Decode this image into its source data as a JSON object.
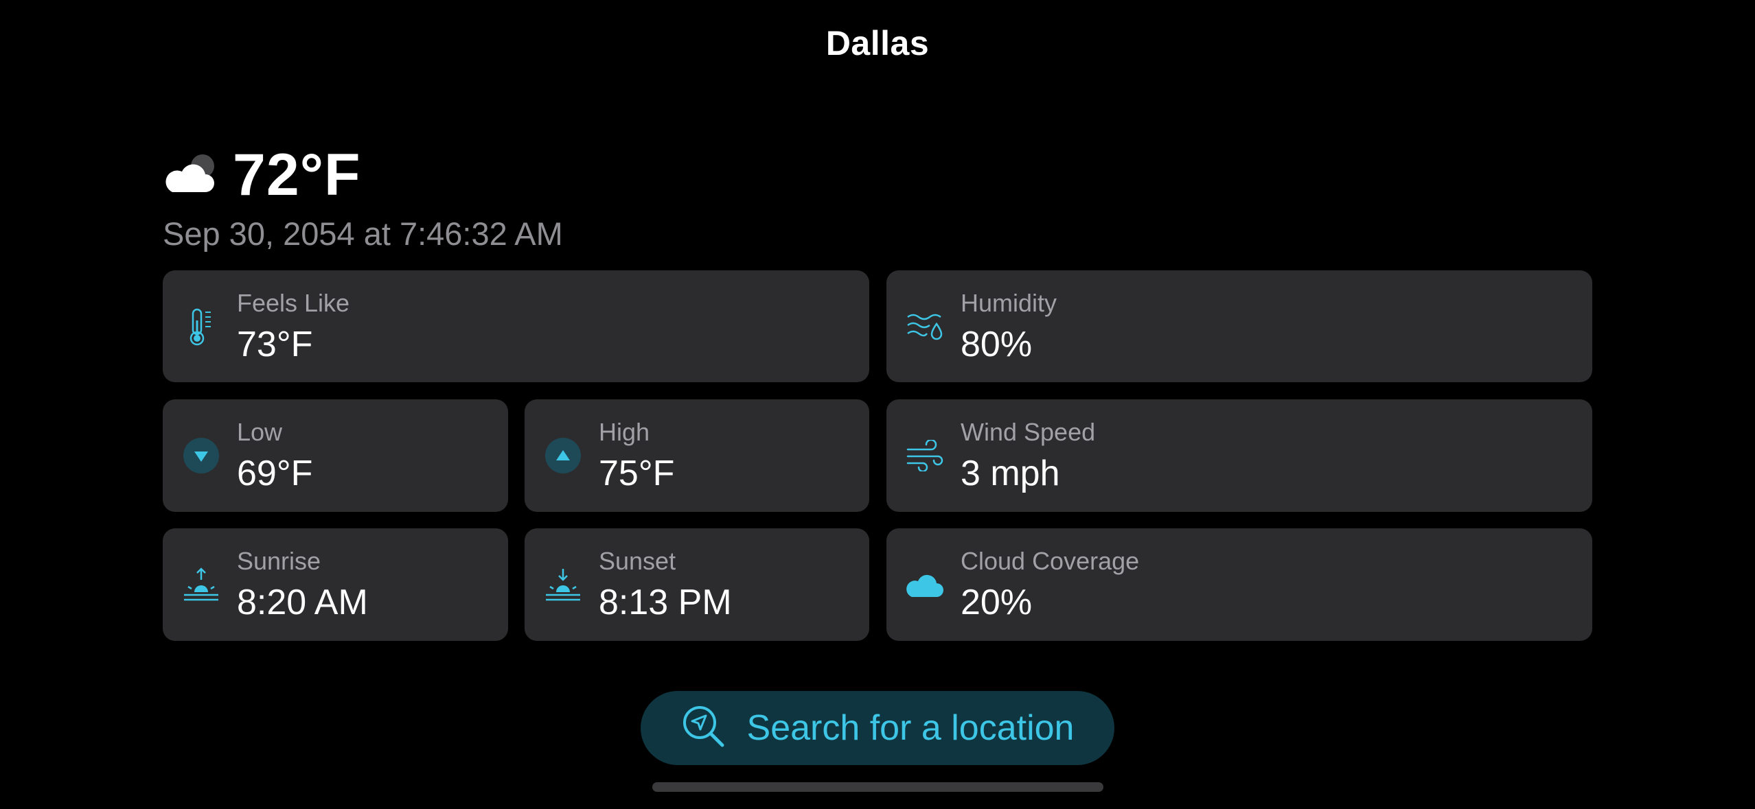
{
  "header": {
    "title": "Dallas"
  },
  "current": {
    "icon": "cloud-moon-icon",
    "temperature": "72°F",
    "timestamp": "Sep 30, 2054 at 7:46:32 AM"
  },
  "cards": {
    "feels_like": {
      "label": "Feels Like",
      "value": "73°F",
      "icon": "thermometer-icon"
    },
    "humidity": {
      "label": "Humidity",
      "value": "80%",
      "icon": "humidity-icon"
    },
    "low": {
      "label": "Low",
      "value": "69°F",
      "icon": "arrow-down-circle-icon"
    },
    "high": {
      "label": "High",
      "value": "75°F",
      "icon": "arrow-up-circle-icon"
    },
    "wind": {
      "label": "Wind Speed",
      "value": "3 mph",
      "icon": "wind-icon"
    },
    "sunrise": {
      "label": "Sunrise",
      "value": "8:20 AM",
      "icon": "sunrise-icon"
    },
    "sunset": {
      "label": "Sunset",
      "value": "8:13 PM",
      "icon": "sunset-icon"
    },
    "cloud": {
      "label": "Cloud Coverage",
      "value": "20%",
      "icon": "cloud-icon"
    }
  },
  "search": {
    "label": "Search for a location",
    "icon": "location-search-icon"
  },
  "colors": {
    "accent": "#3ec6e6",
    "card_bg": "#2c2c2e",
    "search_bg": "#0f3540",
    "secondary_text": "#8e8e93"
  }
}
